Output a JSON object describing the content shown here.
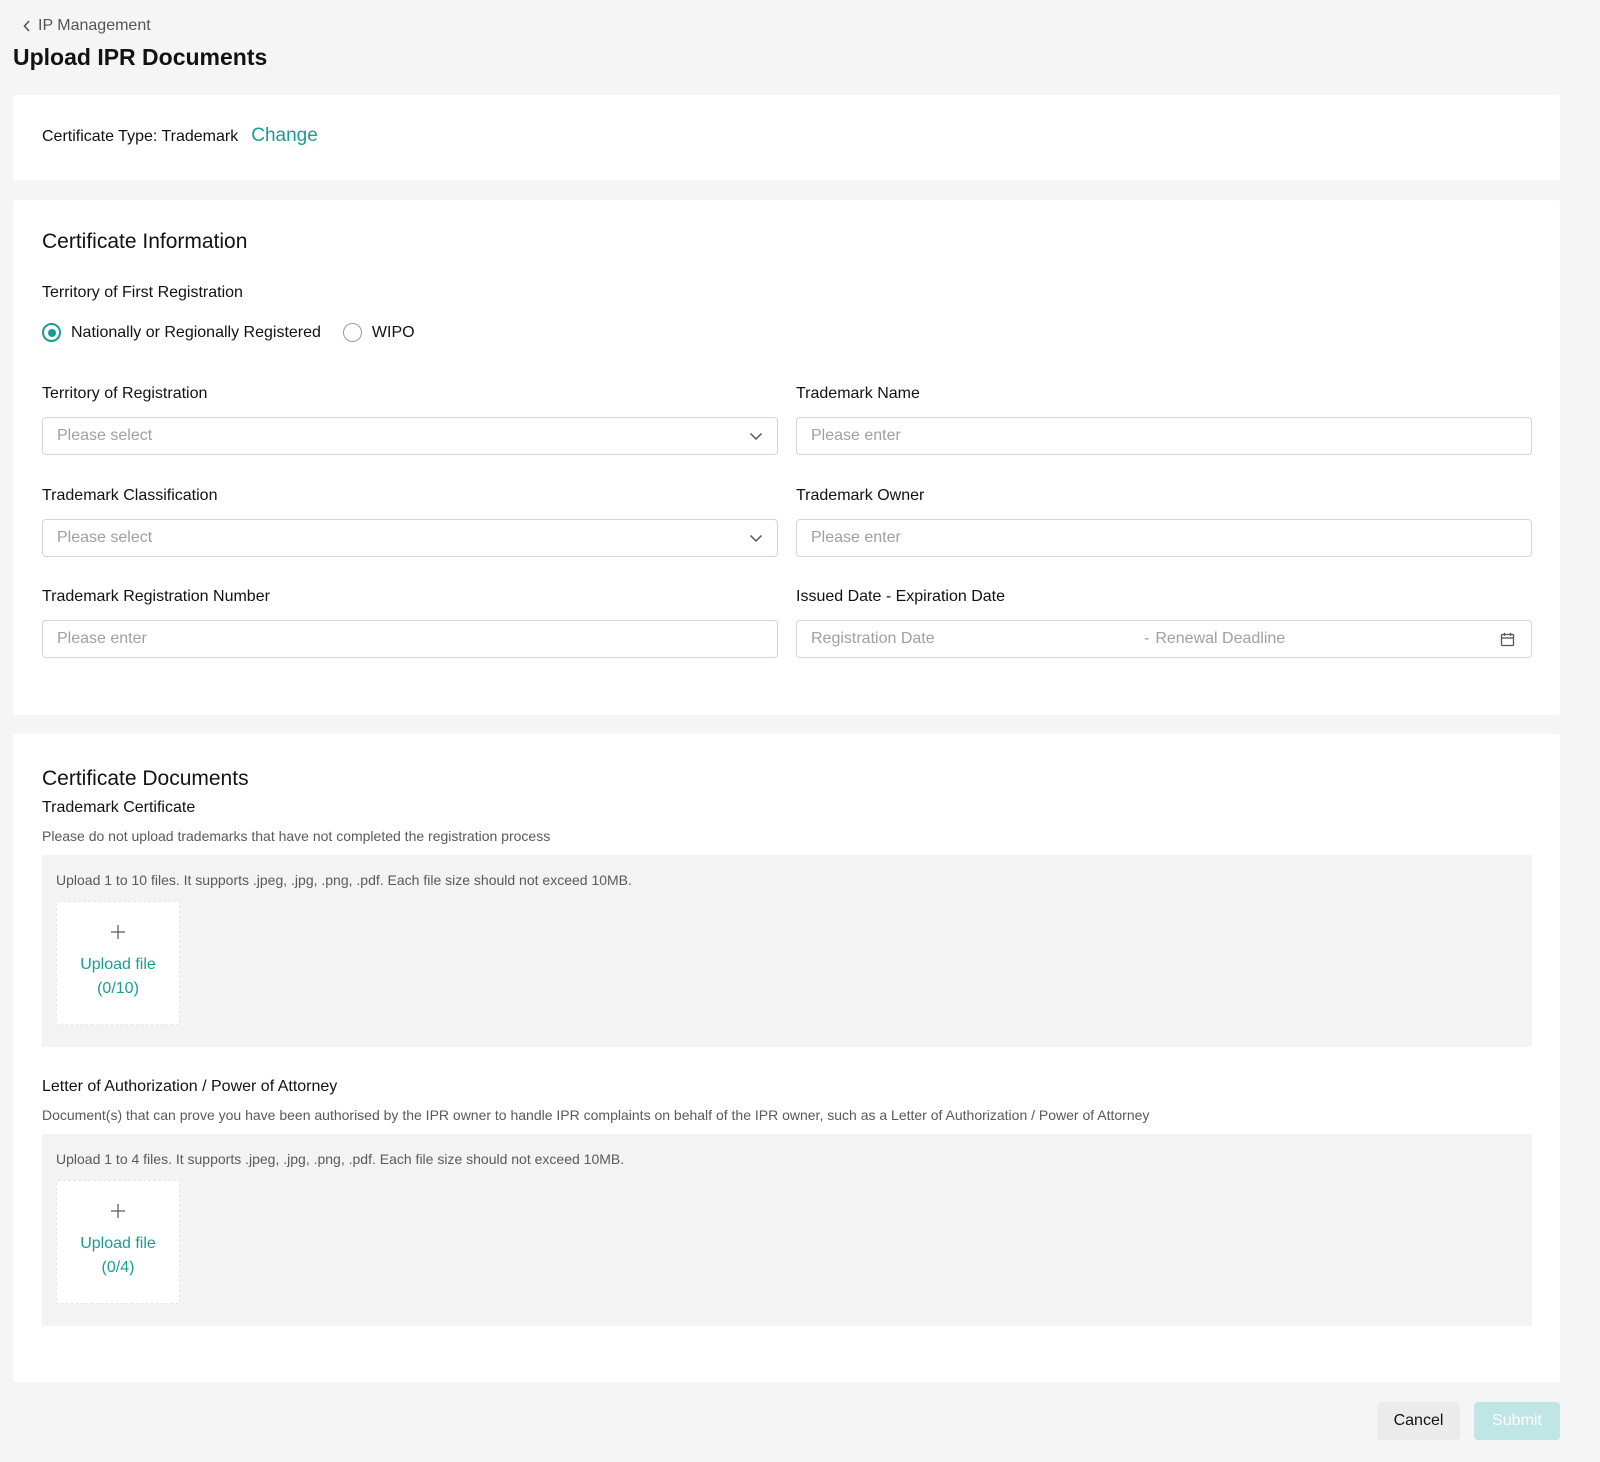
{
  "breadcrumb": {
    "back_label": "IP Management"
  },
  "page": {
    "title": "Upload IPR Documents"
  },
  "certificate_type": {
    "label": "Certificate Type: Trademark",
    "change_label": "Change"
  },
  "info": {
    "title": "Certificate Information",
    "territory_first": {
      "label": "Territory of First Registration",
      "options": [
        {
          "label": "Nationally or Regionally Registered",
          "checked": true
        },
        {
          "label": "WIPO",
          "checked": false
        }
      ]
    },
    "territory_registration": {
      "label": "Territory of Registration",
      "placeholder": "Please select"
    },
    "trademark_name": {
      "label": "Trademark Name",
      "placeholder": "Please enter"
    },
    "trademark_classification": {
      "label": "Trademark Classification",
      "placeholder": "Please select"
    },
    "trademark_owner": {
      "label": "Trademark Owner",
      "placeholder": "Please enter"
    },
    "registration_number": {
      "label": "Trademark Registration Number",
      "placeholder": "Please enter"
    },
    "dates": {
      "label": "Issued Date - Expiration Date",
      "start_placeholder": "Registration Date",
      "separator": "-",
      "end_placeholder": "Renewal Deadline"
    }
  },
  "documents": {
    "title": "Certificate Documents",
    "trademark_certificate": {
      "title": "Trademark Certificate",
      "description": "Please do not upload trademarks that have not completed the registration process",
      "hint": "Upload 1 to 10 files. It supports .jpeg, .jpg, .png, .pdf. Each file size should not exceed 10MB.",
      "upload_label": "Upload file",
      "count": "(0/10)"
    },
    "authorization": {
      "title": "Letter of Authorization / Power of Attorney",
      "description": "Document(s) that can prove you have been authorised by the IPR owner to handle IPR complaints on behalf of the IPR owner, such as a Letter of Authorization / Power of Attorney",
      "hint": "Upload 1 to 4 files. It supports .jpeg, .jpg, .png, .pdf. Each file size should not exceed 10MB.",
      "upload_label": "Upload file",
      "count": "(0/4)"
    }
  },
  "footer": {
    "cancel_label": "Cancel",
    "submit_label": "Submit"
  },
  "colors": {
    "accent": "#1a9b96",
    "submit_disabled": "#bfe6e4"
  },
  "icons": {
    "back": "chevron-left-icon",
    "select": "chevron-down-icon",
    "date": "calendar-icon",
    "upload": "plus-icon"
  }
}
